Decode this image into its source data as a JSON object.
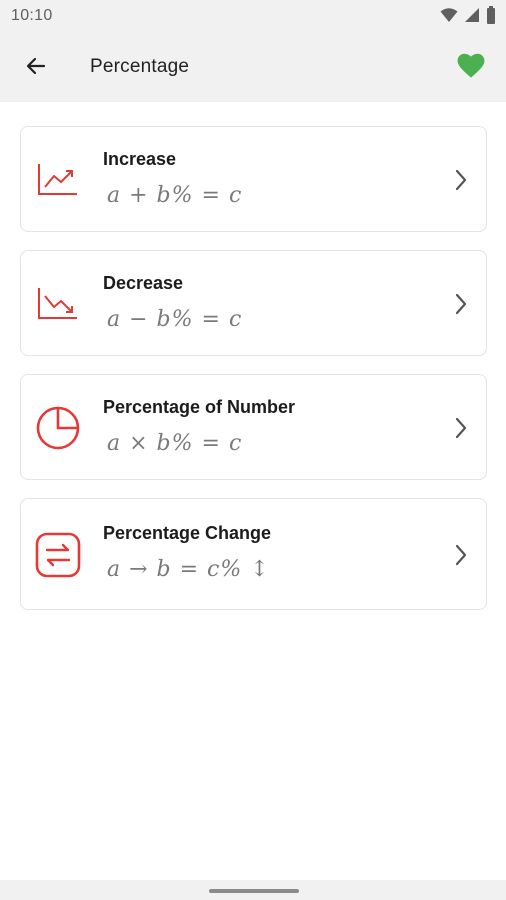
{
  "status_bar": {
    "time": "10:10",
    "icons": [
      "wifi-icon",
      "signal-icon",
      "battery-icon"
    ]
  },
  "app_bar": {
    "back_icon": "arrow-left-icon",
    "title": "Percentage",
    "favorite_icon": "heart-icon",
    "favorite_color": "#4caf50"
  },
  "accent_color": "#e53935",
  "items": [
    {
      "label": "Increase",
      "formula": "a + b% = c",
      "icon": "trending-up-icon"
    },
    {
      "label": "Decrease",
      "formula": "a − b% = c",
      "icon": "trending-down-icon"
    },
    {
      "label": "Percentage of Number",
      "formula": "a × b% = c",
      "icon": "pie-chart-icon"
    },
    {
      "label": "Percentage Change",
      "formula": "a → b = c% ↕",
      "icon": "swap-horizontal-icon"
    }
  ]
}
